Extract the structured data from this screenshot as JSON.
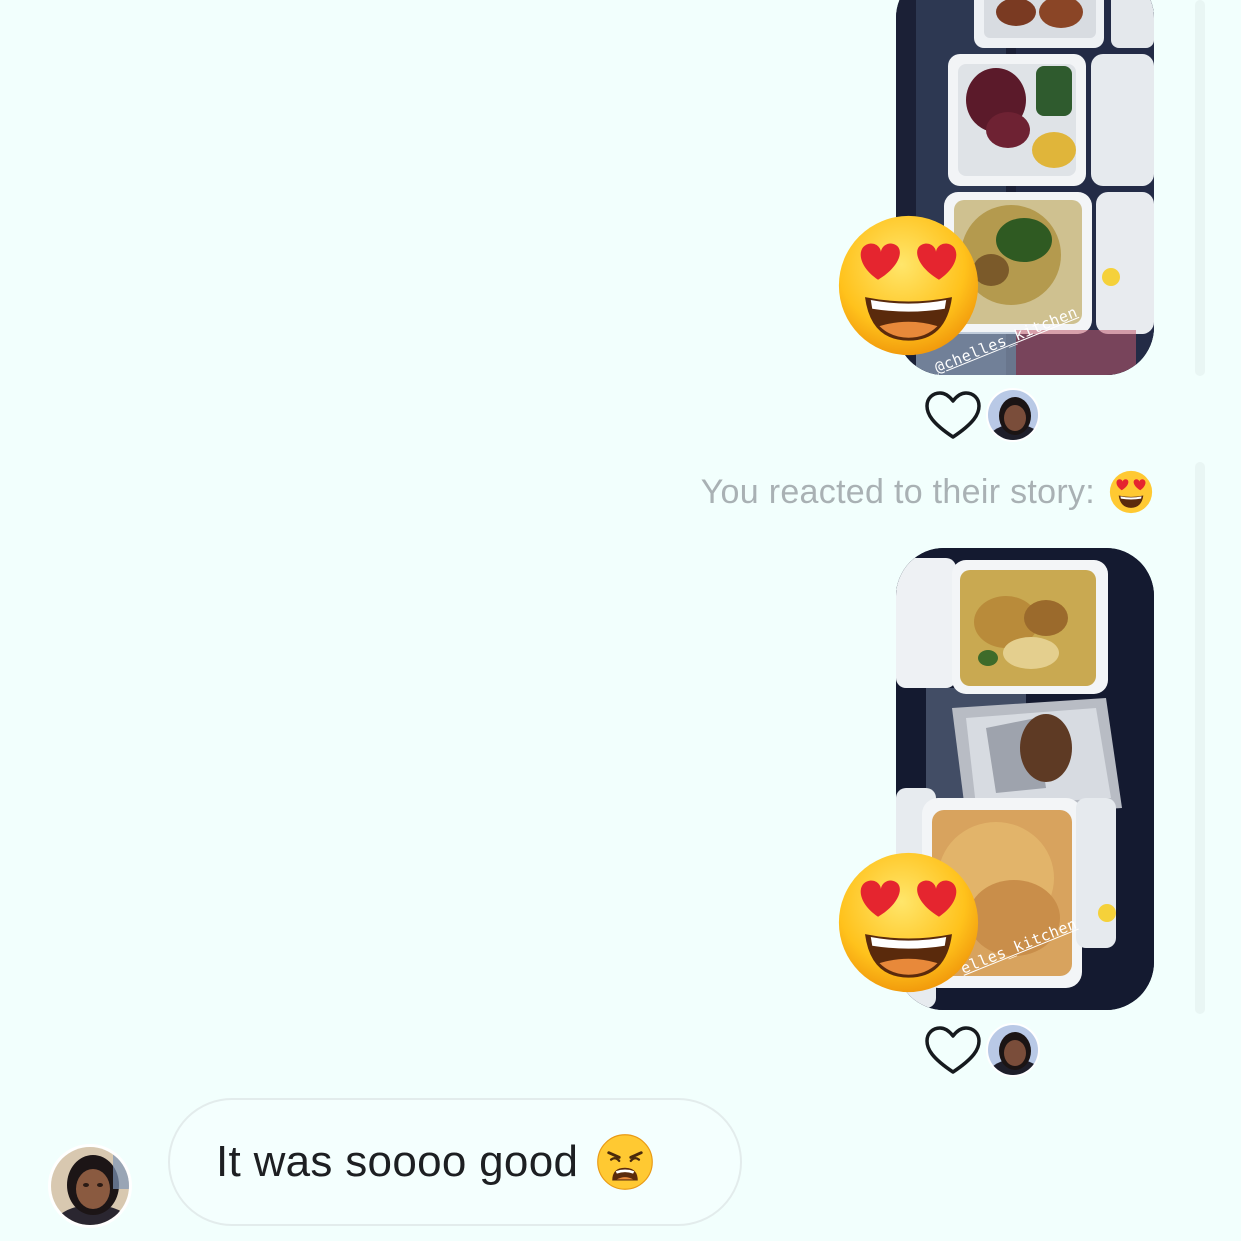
{
  "thread": {
    "stories": [
      {
        "overlay_text": "@chelles_kitchen",
        "reaction_emoji": "heart-eyes-emoji",
        "like_icon": "heart-outline-icon"
      },
      {
        "overlay_text": "elles_kitchen",
        "reaction_emoji": "heart-eyes-emoji",
        "like_icon": "heart-outline-icon"
      }
    ],
    "system_note": {
      "text": "You reacted to their story:",
      "emoji": "heart-eyes-emoji"
    },
    "message": {
      "text": "It was soooo good",
      "emoji": "weary-face-emoji"
    }
  },
  "colors": {
    "background": "#f2fffd",
    "system_text": "#a9b1b4",
    "message_text": "#1d1f22",
    "bubble_border": "#e3ecec"
  }
}
